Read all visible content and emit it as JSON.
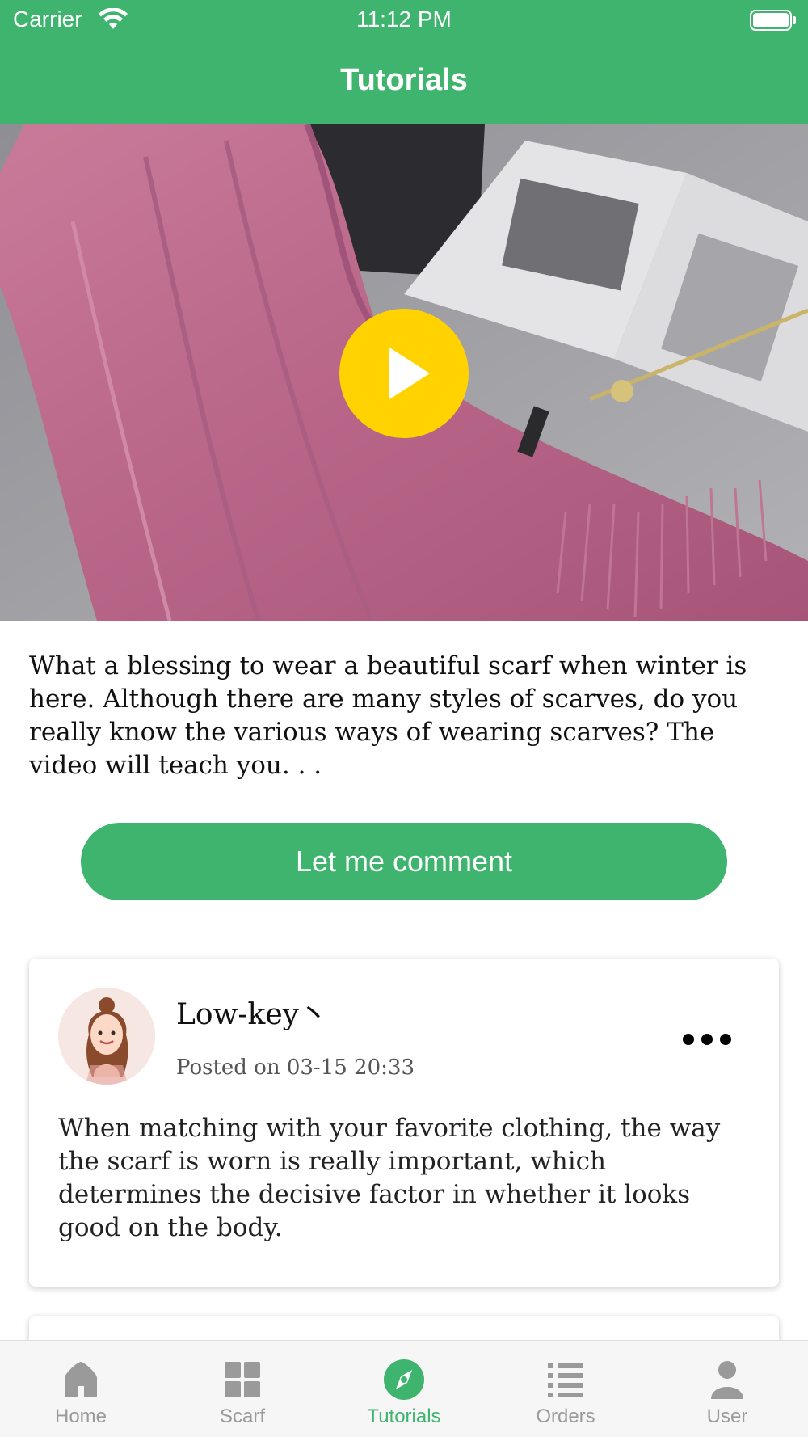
{
  "status_bar": {
    "carrier": "Carrier",
    "time": "11:12 PM"
  },
  "header": {
    "title": "Tutorials"
  },
  "video": {
    "play_icon": "play-icon"
  },
  "description": "What a blessing to wear a beautiful scarf when winter is here. Although there are many styles of scarves, do you really know the various ways of wearing scarves? The video will teach you. . .",
  "comment_button_label": "Let me comment",
  "comments": [
    {
      "username": "Low-key丶",
      "posted": "Posted on 03-15 20:33",
      "text": "When matching with your favorite clothing, the way the scarf is worn is really important, which determines the decisive factor in whether it looks good on the body."
    }
  ],
  "tabs": [
    {
      "label": "Home",
      "icon": "home-icon",
      "active": false
    },
    {
      "label": "Scarf",
      "icon": "grid-icon",
      "active": false
    },
    {
      "label": "Tutorials",
      "icon": "compass-icon",
      "active": true
    },
    {
      "label": "Orders",
      "icon": "list-icon",
      "active": false
    },
    {
      "label": "User",
      "icon": "user-icon",
      "active": false
    }
  ],
  "colors": {
    "accent": "#3fb46e",
    "play": "#ffd200",
    "tab_inactive": "#9a9a9a"
  }
}
